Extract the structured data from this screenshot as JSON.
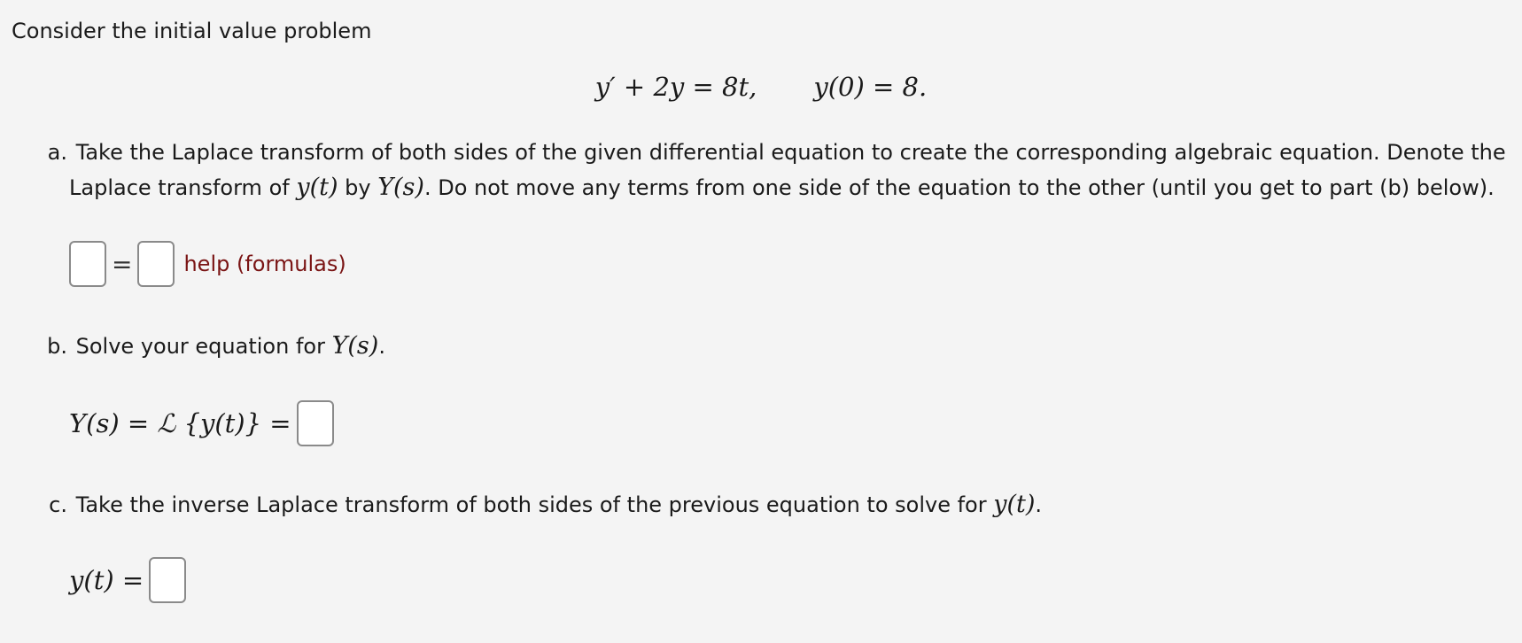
{
  "problem": {
    "intro": "Consider the initial value problem",
    "ode_lhs": "y′ + 2y = 8t,",
    "initial_condition": "y(0) = 8."
  },
  "part_a": {
    "label": "a.",
    "text_1": "Take the Laplace transform of both sides of the given differential equation to create the corresponding algebraic equation. Denote the",
    "text_2_pre": "Laplace transform of ",
    "text_2_y": "y(t)",
    "text_2_by": " by ",
    "text_2_Y": "Y(s)",
    "text_2_post": ". Do not move any terms from one side of the equation to the other (until you get to part (b) below).",
    "equals": "=",
    "help_link": "help (formulas)"
  },
  "part_b": {
    "label": "b.",
    "text_pre": "Solve your equation for ",
    "text_Y": "Y(s)",
    "text_post": ".",
    "answer_lhs": "Y(s) = ℒ {y(t)} ="
  },
  "part_c": {
    "label": "c.",
    "text_pre": "Take the inverse Laplace transform of both sides of the previous equation to solve for ",
    "text_y": "y(t)",
    "text_post": ".",
    "answer_lhs": "y(t) ="
  }
}
